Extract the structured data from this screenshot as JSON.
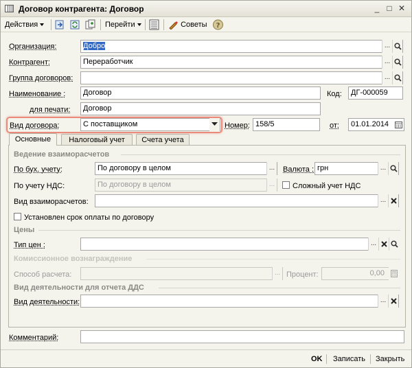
{
  "window": {
    "title": "Договор контрагента: Договор",
    "controls": {
      "minimize": "_",
      "maximize": "□",
      "close": "✕"
    }
  },
  "toolbar": {
    "actions_label": "Действия",
    "goto_label": "Перейти",
    "tips_label": "Советы"
  },
  "form": {
    "organization": {
      "label": "Организация:",
      "value": "Добро"
    },
    "counterparty": {
      "label": "Контрагент:",
      "value": "Переработчик"
    },
    "contract_group": {
      "label": "Группа договоров:",
      "value": ""
    },
    "name": {
      "label": "Наименование :",
      "value": "Договор"
    },
    "code": {
      "label": "Код:",
      "value": "ДГ-000059"
    },
    "print_name": {
      "label": "для печати:",
      "value": "Договор"
    },
    "contract_type": {
      "label": "Вид договора:",
      "value": "С поставщиком"
    },
    "number": {
      "label": "Номер:",
      "value": "158/5"
    },
    "date": {
      "label": "от:",
      "value": "01.01.2014"
    },
    "comment": {
      "label": "Комментарий:",
      "value": ""
    }
  },
  "tabs": [
    {
      "label": "Основные"
    },
    {
      "label": "Налоговый учет"
    },
    {
      "label": "Счета учета"
    }
  ],
  "main_tab": {
    "settlements_section": "Ведение взаиморасчетов",
    "accounting": {
      "label": "По бух. учету:",
      "value": "По договору в целом"
    },
    "currency": {
      "label": "Валюта :",
      "value": "грн"
    },
    "vat": {
      "label": "По учету НДС:",
      "value": "По договору в целом"
    },
    "complex_vat": {
      "label": "Сложный  учет НДС"
    },
    "settlement_type": {
      "label": "Вид взаиморасчетов:",
      "value": ""
    },
    "payment_term": {
      "label": "Установлен срок оплаты по договору"
    },
    "prices_section": "Цены",
    "price_type": {
      "label": "Тип цен :",
      "value": ""
    },
    "commission_section": "Комиссионное вознаграждение",
    "calc_method": {
      "label": "Способ расчета:",
      "value": ""
    },
    "percent": {
      "label": "Процент:",
      "value": "0,00"
    },
    "dds_section": "Вид деятельности для отчета ДДС",
    "activity": {
      "label": "Вид деятельности:",
      "value": ""
    }
  },
  "footer": {
    "ok_label": "OK",
    "save_label": "Записать",
    "close_label": "Закрыть"
  }
}
